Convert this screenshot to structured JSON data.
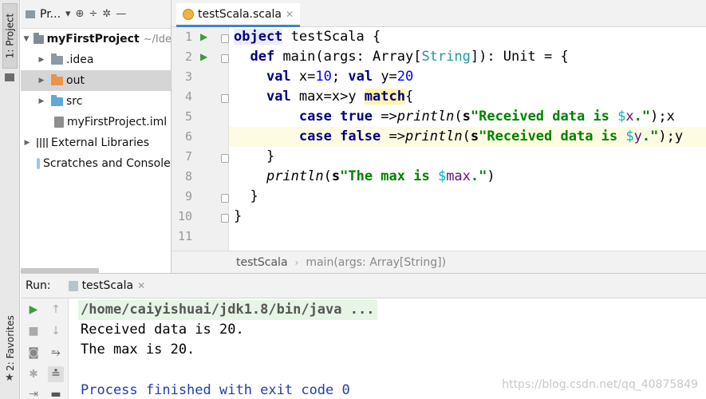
{
  "tool_strip": {
    "project_tab": "1: Project",
    "favorites_tab": "2: Favorites"
  },
  "project_panel": {
    "title": "Pr...",
    "tree": [
      {
        "label": "myFirstProject",
        "detail": "~/Ide",
        "icon": "folder-icon",
        "expanded": true
      },
      {
        "label": ".idea",
        "icon": "folder-icon"
      },
      {
        "label": "out",
        "icon": "folder-icon",
        "selected": true
      },
      {
        "label": "src",
        "icon": "folder-icon"
      },
      {
        "label": "myFirstProject.iml",
        "icon": "iml-file-icon"
      },
      {
        "label": "External Libraries",
        "icon": "library-icon"
      },
      {
        "label": "Scratches and Consoles",
        "icon": "scratches-icon"
      }
    ]
  },
  "editor": {
    "tab_label": "testScala.scala",
    "line_numbers": [
      "1",
      "2",
      "3",
      "4",
      "5",
      "6",
      "7",
      "8",
      "9",
      "10",
      "11"
    ],
    "current_line": "6",
    "breadcrumb": [
      "testScala",
      "main(args: Array[String])"
    ],
    "code": {
      "l1": {
        "k": "object",
        "t": " testScala {"
      },
      "l2": {
        "k": "def",
        "a": " main(args: Array[",
        "ty": "String",
        "b": "]): Unit = {"
      },
      "l3": {
        "k1": "val",
        "a": " x=",
        "n1": "10",
        "b": "; ",
        "k2": "val",
        "c": " y=",
        "n2": "20"
      },
      "l4": {
        "k": "val",
        "a": " max=x>y ",
        "m": "match",
        "b": "{"
      },
      "l5": {
        "k1": "case",
        "s1": " ",
        "k2": "true",
        "a": " =>",
        "f": "println",
        "b": "(",
        "s": "s",
        "q1": "\"Received data is ",
        "d": "$",
        "v": "x",
        "q2": ".\"",
        "c": ");x"
      },
      "l6": {
        "k1": "case",
        "s1": " ",
        "k2": "false",
        "a": " =>",
        "f": "println",
        "b": "(",
        "s": "s",
        "q1": "\"Received data is ",
        "d": "$",
        "v": "y",
        "q2": ".\"",
        "c": ");y"
      },
      "l7": {
        "t": "}"
      },
      "l8": {
        "f": "println",
        "b": "(",
        "s": "s",
        "q1": "\"The max is ",
        "d": "$",
        "v": "max",
        "q2": ".\"",
        "c": ")"
      },
      "l9": {
        "t": "}"
      },
      "l10": {
        "t": "}"
      }
    }
  },
  "run_panel": {
    "label": "Run:",
    "tab_label": "testScala",
    "output": [
      "/home/caiyishuai/jdk1.8/bin/java ...",
      "Received data is 20.",
      "The max is 20.",
      "",
      "Process finished with exit code 0"
    ],
    "watermark": "https://blog.csdn.net/qq_40875849"
  }
}
